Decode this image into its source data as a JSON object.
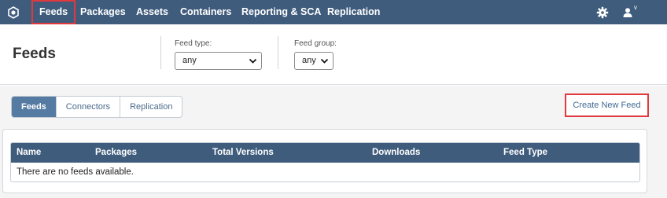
{
  "nav": {
    "items": [
      "Feeds",
      "Packages",
      "Assets",
      "Containers",
      "Reporting & SCA",
      "Replication"
    ],
    "active": "Feeds",
    "user_caret": "v"
  },
  "header": {
    "title": "Feeds",
    "feed_type": {
      "label": "Feed type:",
      "value": "any"
    },
    "feed_group": {
      "label": "Feed group:",
      "value": "any"
    }
  },
  "tabs": [
    "Feeds",
    "Connectors",
    "Replication"
  ],
  "active_tab": "Feeds",
  "create_button": "Create New Feed",
  "table": {
    "columns": [
      "Name",
      "Packages",
      "Total Versions",
      "Downloads",
      "Feed Type"
    ],
    "empty_message": "There are no feeds available."
  },
  "colors": {
    "nav_bg": "#3f5c7d",
    "highlight": "#e0393e",
    "tab_active": "#557ba2"
  },
  "icons": [
    "logo-icon",
    "gear-icon",
    "user-icon",
    "chevron-down-icon"
  ]
}
